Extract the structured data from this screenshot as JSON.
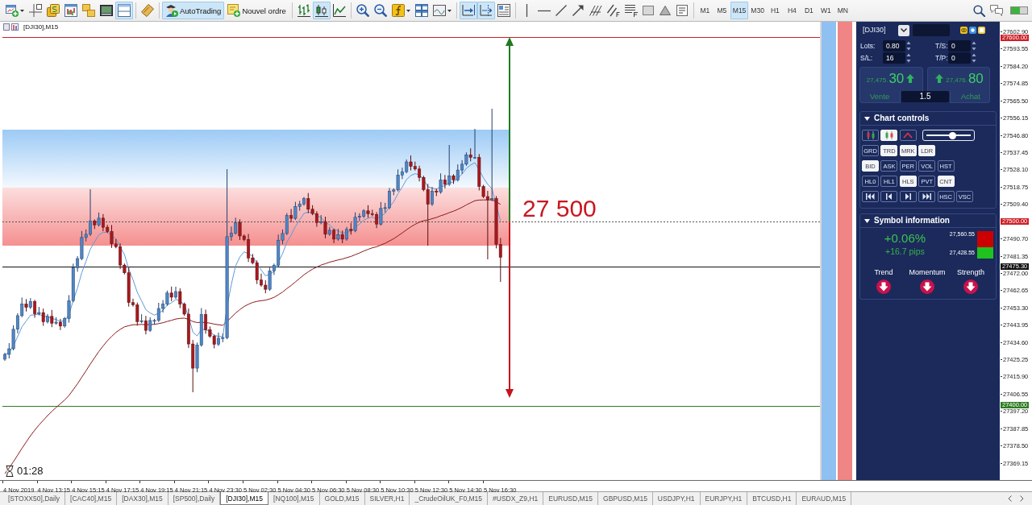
{
  "toolbar": {
    "left_tools": [
      {
        "selected": false
      },
      {
        "selected": false
      },
      {
        "selected": false
      },
      {
        "selected": false
      },
      {
        "selected": false
      },
      {
        "selected": false
      },
      {
        "selected": true
      },
      {
        "selected": false
      }
    ],
    "buttons": [
      {
        "label": "AutoTrading",
        "selected": true
      },
      {
        "label": "Nouvel ordre",
        "selected": false
      }
    ],
    "chart_types": [
      {
        "selected": false
      },
      {
        "selected": true
      },
      {
        "selected": false
      }
    ],
    "view_tools": [
      {
        "selected": false
      },
      {
        "selected": false
      },
      {
        "selected": false
      },
      {
        "selected": false
      },
      {
        "selected": false
      },
      {
        "selected": true
      },
      {
        "selected": true
      },
      {
        "selected": false
      }
    ],
    "timeframes": [
      {
        "label": "M1",
        "selected": false
      },
      {
        "label": "M5",
        "selected": false
      },
      {
        "label": "M15",
        "selected": true
      },
      {
        "label": "M30",
        "selected": false
      },
      {
        "label": "H1",
        "selected": false
      },
      {
        "label": "H4",
        "selected": false
      },
      {
        "label": "D1",
        "selected": false
      },
      {
        "label": "W1",
        "selected": false
      },
      {
        "label": "MN",
        "selected": false
      }
    ]
  },
  "chart": {
    "title": "[DJI30],M15",
    "zones": [
      {
        "color": "#9ccaf5"
      },
      {
        "color": "#f59090"
      }
    ],
    "price_lines": [
      {
        "label": "27600.00",
        "color": "#cc1f26"
      },
      {
        "label": "27500.00",
        "color": "#cc1f26"
      },
      {
        "label": "27475.30",
        "color": "#111111"
      },
      {
        "label": "27400.00",
        "color": "#2e7d22"
      }
    ],
    "target_label": "27 500",
    "timer": "01:28",
    "indicator_strips": [
      {
        "color": "#8fc0f2"
      },
      {
        "color": "#f08585"
      }
    ],
    "price_ticks": [
      "27602.90",
      "27593.55",
      "27584.20",
      "27574.85",
      "27565.50",
      "27556.15",
      "27546.80",
      "27537.45",
      "27528.10",
      "27518.75",
      "27509.40",
      "27490.70",
      "27481.35",
      "27472.00",
      "27462.65",
      "27453.30",
      "27443.95",
      "27434.60",
      "27425.25",
      "27415.90",
      "27406.55",
      "27397.20",
      "27387.85",
      "27378.50",
      "27369.15"
    ],
    "time_ticks": [
      "4 Nov 2019",
      "4 Nov 13:15",
      "4 Nov 15:15",
      "4 Nov 17:15",
      "4 Nov 19:15",
      "4 Nov 21:15",
      "4 Nov 23:30",
      "5 Nov 02:30",
      "5 Nov 04:30",
      "5 Nov 06:30",
      "5 Nov 08:30",
      "5 Nov 10:30",
      "5 Nov 12:30",
      "5 Nov 14:30",
      "5 Nov 16:30"
    ]
  },
  "trade_panel": {
    "symbol": "[DJI30]",
    "order_fields": [
      {
        "label": "Lots:",
        "value": "0.80"
      },
      {
        "label": "T/S:",
        "value": "0"
      },
      {
        "label": "S/L:",
        "value": "16"
      },
      {
        "label": "T/P:",
        "value": "0"
      }
    ],
    "quotes": [
      {
        "price": "27,475.",
        "pips": "30",
        "label": "Vente"
      },
      {
        "price": "27,476.",
        "pips": "80",
        "label": "Achat"
      }
    ],
    "volume": "1.5",
    "chart_controls": {
      "title": "Chart controls",
      "expanded": true,
      "chart_types": [
        {
          "on": false
        },
        {
          "on": true
        },
        {
          "on": false
        }
      ],
      "zoom": {
        "level": 0.6
      },
      "rows": [
        [
          {
            "label": "GRD",
            "on": false
          },
          {
            "label": "TRD",
            "on": true
          },
          {
            "label": "MRK",
            "on": true
          },
          {
            "label": "LDR",
            "on": true
          }
        ],
        [
          {
            "label": "BID",
            "on": true
          },
          {
            "label": "ASK",
            "on": false
          },
          {
            "label": "PER",
            "on": false
          },
          {
            "label": "VOL",
            "on": false
          },
          {
            "label": "HST",
            "on": false
          }
        ],
        [
          {
            "label": "HL0",
            "on": false
          },
          {
            "label": "HL1",
            "on": false
          },
          {
            "label": "HLS",
            "on": true
          },
          {
            "label": "PVT",
            "on": false
          },
          {
            "label": "CNT",
            "on": true
          }
        ]
      ],
      "nav": [
        {
          "label": "HSC",
          "on": false
        },
        {
          "label": "VSC",
          "on": false
        }
      ]
    },
    "symbol_info": {
      "title": "Symbol information",
      "expanded": true,
      "change": "+0.06%",
      "pips": "+16.7 pips",
      "range": [
        {
          "value": "27,560.55",
          "color": "#cc0000"
        },
        {
          "value": "27,428.55",
          "color": "#1fc21f"
        }
      ],
      "signals": [
        {
          "label": "Trend"
        },
        {
          "label": "Momentum"
        },
        {
          "label": "Strength"
        }
      ]
    }
  },
  "tabs": [
    {
      "label": "[STOXX50],Daily",
      "selected": false
    },
    {
      "label": "[CAC40],M15",
      "selected": false
    },
    {
      "label": "[DAX30],M15",
      "selected": false
    },
    {
      "label": "[SP500],Daily",
      "selected": false
    },
    {
      "label": "[DJI30],M15",
      "selected": true
    },
    {
      "label": "[NQ100],M15",
      "selected": false
    },
    {
      "label": "GOLD,M15",
      "selected": false
    },
    {
      "label": "SILVER,H1",
      "selected": false
    },
    {
      "label": "_CrudeOilUK_F0,M15",
      "selected": false
    },
    {
      "label": "#USDX_Z9,H1",
      "selected": false
    },
    {
      "label": "EURUSD,M15",
      "selected": false
    },
    {
      "label": "GBPUSD,M15",
      "selected": false
    },
    {
      "label": "USDJPY,H1",
      "selected": false
    },
    {
      "label": "EURJPY,H1",
      "selected": false
    },
    {
      "label": "BTCUSD,H1",
      "selected": false
    },
    {
      "label": "EURAUD,M15",
      "selected": false
    }
  ]
}
